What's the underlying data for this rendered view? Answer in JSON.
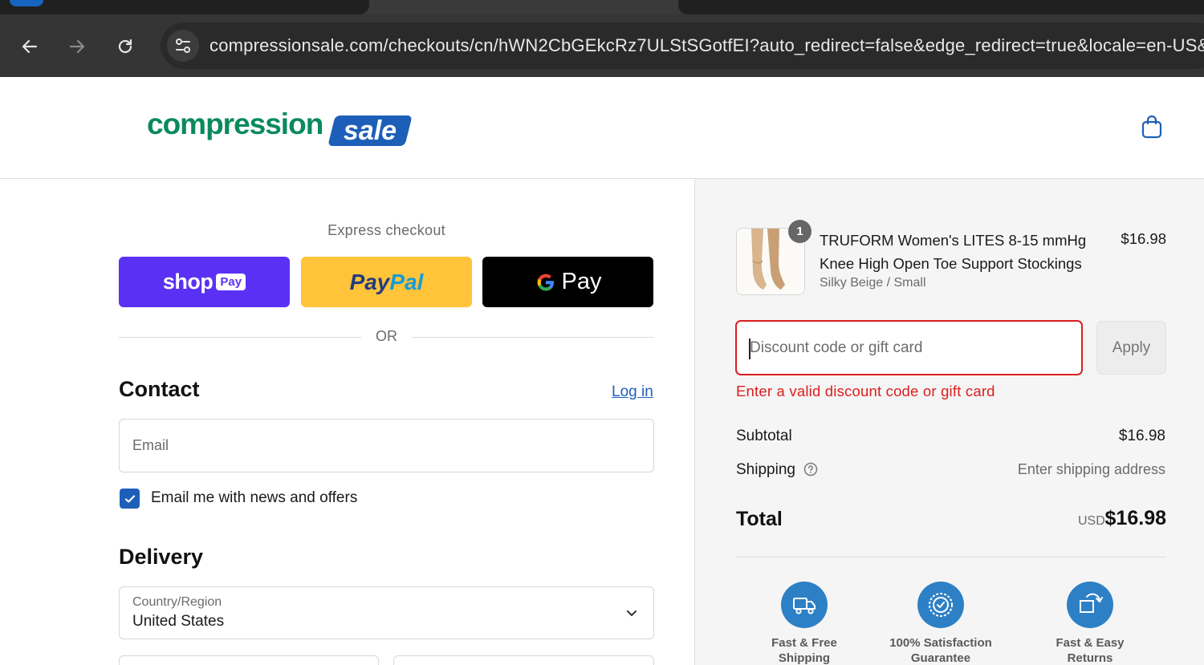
{
  "browser": {
    "url": "compressionsale.com/checkouts/cn/hWN2CbGEkcRz7ULStSGotfEI?auto_redirect=false&edge_redirect=true&locale=en-US&"
  },
  "header": {
    "logo_primary": "compression",
    "logo_secondary": "sale"
  },
  "express": {
    "label": "Express checkout",
    "shoppay_label": "shop",
    "shoppay_tag": "Pay",
    "paypal_label_1": "Pay",
    "paypal_label_2": "Pal",
    "gpay_label": "Pay"
  },
  "separator": "OR",
  "contact": {
    "heading": "Contact",
    "login_link": "Log in",
    "email_placeholder": "Email",
    "newsletter_label": "Email me with news and offers",
    "newsletter_checked": true
  },
  "delivery": {
    "heading": "Delivery",
    "country_label": "Country/Region",
    "country_value": "United States"
  },
  "summary": {
    "product": {
      "title": "TRUFORM Women's LITES 8-15 mmHg Knee High Open Toe Support Stockings",
      "variant": "Silky Beige / Small",
      "price": "$16.98",
      "quantity": "1"
    },
    "discount": {
      "placeholder": "Discount code or gift card",
      "apply_label": "Apply",
      "error": "Enter a valid discount code or gift card"
    },
    "subtotal_label": "Subtotal",
    "subtotal_value": "$16.98",
    "shipping_label": "Shipping",
    "shipping_value": "Enter shipping address",
    "total_label": "Total",
    "total_currency": "USD",
    "total_value": "$16.98",
    "badges": [
      {
        "line1": "Fast & Free",
        "line2": "Shipping",
        "icon": "truck-icon"
      },
      {
        "line1": "100% Satisfaction",
        "line2": "Guarantee",
        "icon": "seal-icon"
      },
      {
        "line1": "Fast & Easy",
        "line2": "Returns",
        "icon": "return-icon"
      }
    ]
  },
  "colors": {
    "brand_blue": "#1d5fb8",
    "brand_green": "#0a8a5c",
    "error_red": "#dd1d1d",
    "shoppay_purple": "#5a31f4",
    "paypal_yellow": "#ffc439"
  }
}
